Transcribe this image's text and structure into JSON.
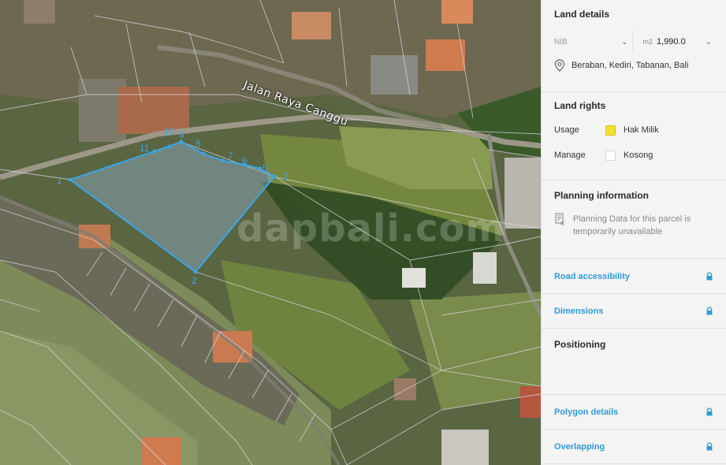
{
  "map": {
    "road_label": "Jalan Raya Canggu",
    "watermark": "dapbali.com",
    "vertex_labels": [
      "1",
      "2",
      "3",
      "5",
      "6",
      "7",
      "8",
      "9",
      "10",
      "11"
    ],
    "colors": {
      "parcel_outline": "#3fa3e0",
      "parcel_fill": "rgba(140,175,200,0.45)"
    }
  },
  "panel": {
    "land_details": {
      "title": "Land details",
      "nib_placeholder": "NIB",
      "area_unit": "m2",
      "area_value": "1,990.0",
      "location": "Beraban, Kediri, Tabanan, Bali",
      "icons": [
        "chevron-down-icon",
        "location-pin-icon"
      ]
    },
    "land_rights": {
      "title": "Land rights",
      "usage_label": "Usage",
      "usage_value": "Hak Milik",
      "usage_color": "#f5e12c",
      "manage_label": "Manage",
      "manage_value": "Kosong",
      "manage_color": "#ffffff"
    },
    "planning": {
      "title": "Planning information",
      "message": "Planning Data for this parcel is temporarily unavailable",
      "icon": "document-unavailable-icon"
    },
    "road_accessibility": {
      "label": "Road accessibility",
      "icon": "lock-icon"
    },
    "dimensions": {
      "label": "Dimensions",
      "icon": "lock-icon"
    },
    "positioning": {
      "title": "Positioning"
    },
    "polygon_details": {
      "label": "Polygon details",
      "icon": "lock-icon"
    },
    "overlapping": {
      "label": "Overlapping",
      "icon": "lock-icon"
    },
    "colors": {
      "link": "#2f9ad8",
      "panel_bg": "#f4f4f4"
    }
  }
}
